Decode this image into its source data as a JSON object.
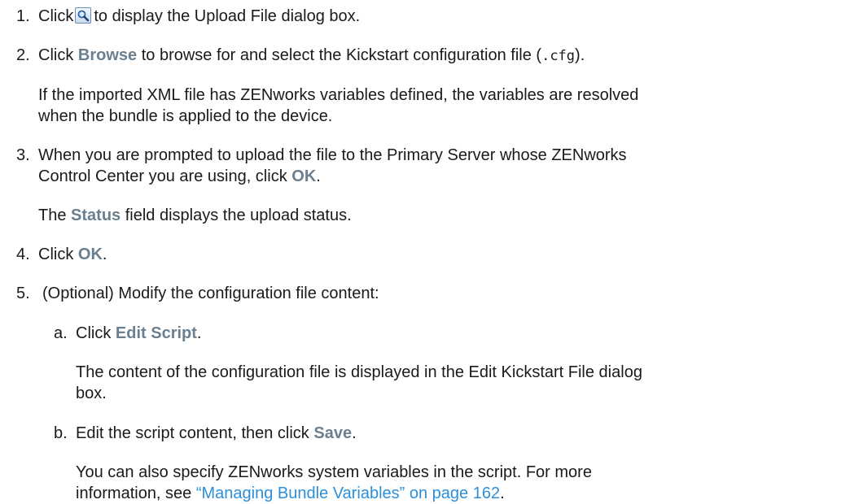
{
  "steps": {
    "s1": {
      "num": "1.",
      "pre": "Click",
      "icon": "magnifier-icon",
      "post": "to display the Upload File dialog box."
    },
    "s2": {
      "num": "2.",
      "pre": "Click",
      "ui": "Browse",
      "mid": "to browse for and select the Kickstart configuration file (",
      "code": ".cfg",
      "post": ")."
    },
    "s2_note": {
      "line1": "If the imported XML file has ZENworks variables defined, the variables are resolved",
      "line2": "when the bundle is applied to the device."
    },
    "s3": {
      "num": "3.",
      "line1": "When you are prompted to upload the file to the Primary Server whose ZENworks",
      "line2_pre": "Control Center you are using, click",
      "ui": "OK",
      "line2_post": "."
    },
    "s3_note": {
      "pre": "The",
      "ui": "Status",
      "post": "field displays the upload status."
    },
    "s4": {
      "num": "4.",
      "pre": "Click",
      "ui": "OK",
      "post": "."
    },
    "s5": {
      "num": "5.",
      "text": "(Optional) Modify the configuration file content:"
    },
    "s5a": {
      "num": "a.",
      "pre": "Click",
      "ui": "Edit Script",
      "post": "."
    },
    "s5a_note": {
      "line1": "The content of the configuration file is displayed in the Edit Kickstart File dialog",
      "line2": "box."
    },
    "s5b": {
      "num": "b.",
      "pre": "Edit the script content, then click",
      "ui": "Save",
      "post": "."
    },
    "s5b_note": {
      "line1": "You can also specify ZENworks system variables in the script. For more",
      "line2_pre": "information, see",
      "link": "“Managing Bundle Variables” on page 162",
      "line2_post": "."
    }
  },
  "colors": {
    "text": "#1a1a1a",
    "ui_term": "#6a7f8f",
    "link": "#2c8fd8"
  }
}
